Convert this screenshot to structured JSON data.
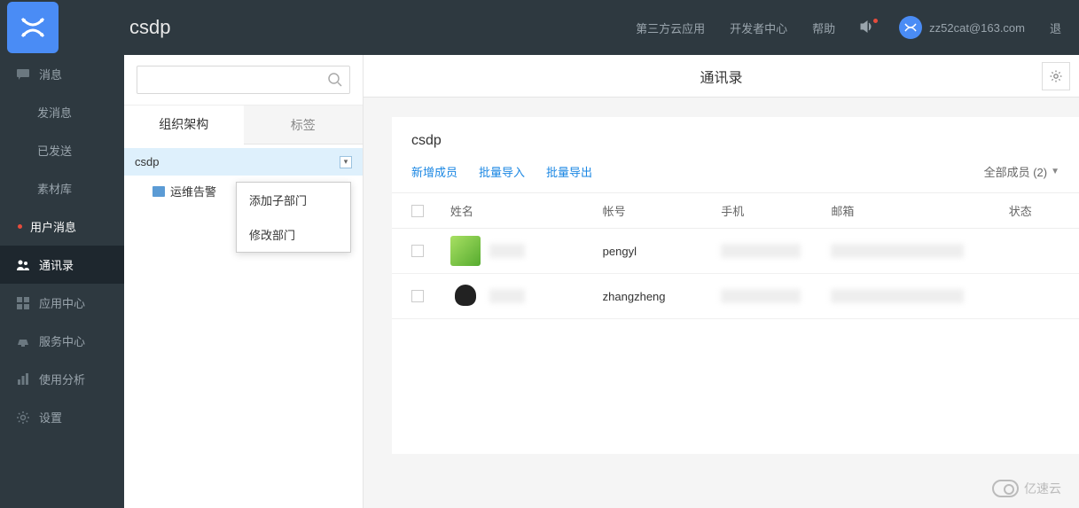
{
  "header": {
    "app_name": "csdp",
    "links": {
      "cloud_apps": "第三方云应用",
      "dev_center": "开发者中心",
      "help": "帮助",
      "logout": "退"
    },
    "user_email": "zz52cat@163.com"
  },
  "nav": {
    "messages": "消息",
    "send_msg": "发消息",
    "sent": "已发送",
    "materials": "素材库",
    "user_msg": "用户消息",
    "contacts": "通讯录",
    "app_center": "应用中心",
    "service_center": "服务中心",
    "usage_analytics": "使用分析",
    "settings": "设置"
  },
  "mid": {
    "search_placeholder": "",
    "tab_org": "组织架构",
    "tab_tag": "标签",
    "root": "csdp",
    "child1": "运维告警"
  },
  "context_menu": {
    "add_child": "添加子部门",
    "edit_dept": "修改部门"
  },
  "main": {
    "title": "通讯录",
    "card_title": "csdp",
    "actions": {
      "add_member": "新增成员",
      "bulk_import": "批量导入",
      "bulk_export": "批量导出"
    },
    "count_label": "全部成员 (2)",
    "columns": {
      "name": "姓名",
      "account": "帐号",
      "phone": "手机",
      "email": "邮箱",
      "status": "状态"
    },
    "rows": [
      {
        "account": "pengyl"
      },
      {
        "account": "zhangzheng"
      }
    ]
  },
  "watermark": "亿速云"
}
